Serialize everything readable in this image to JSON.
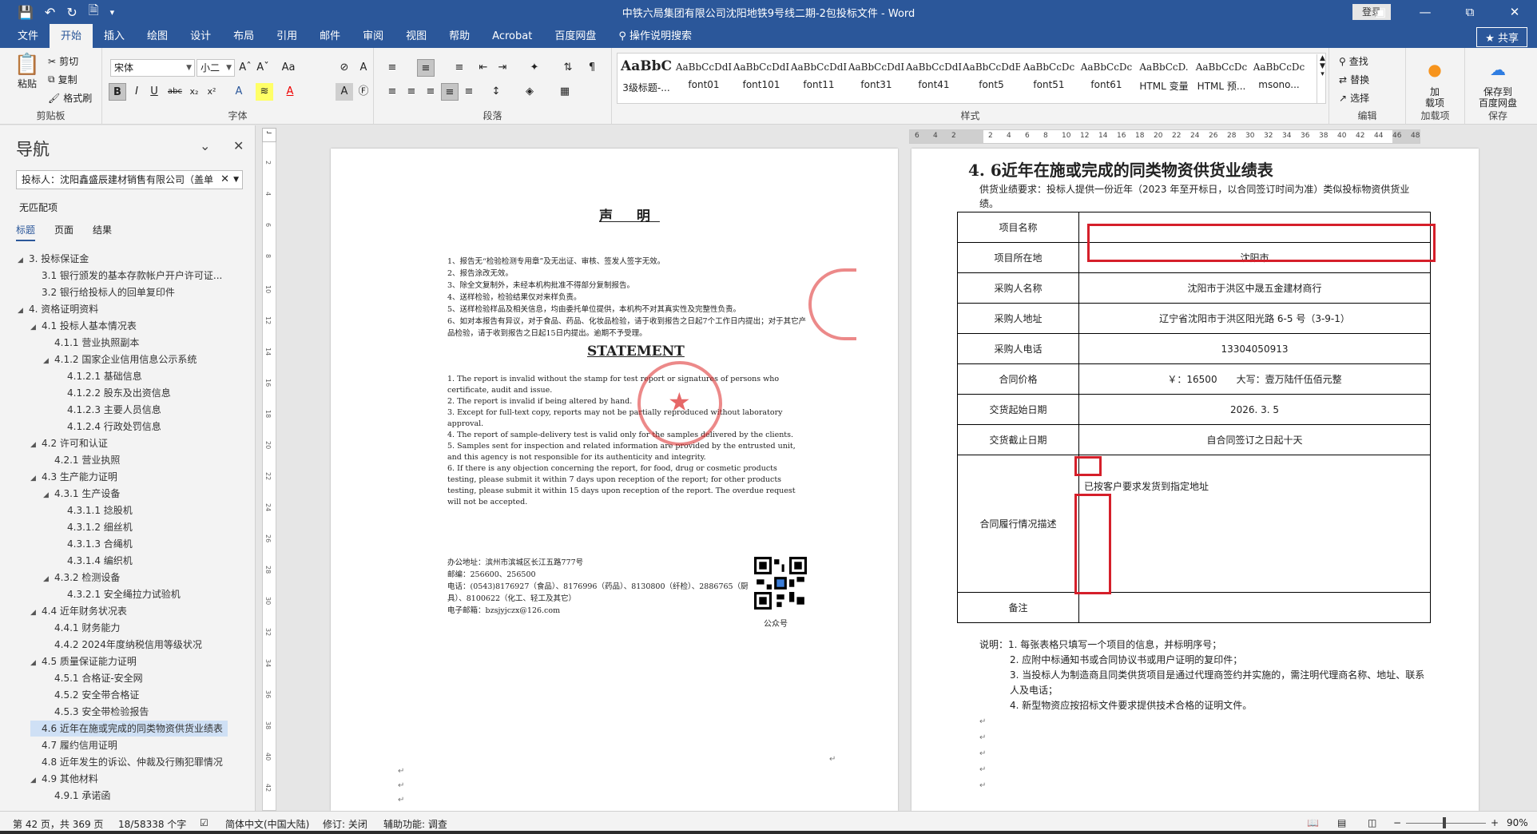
{
  "window": {
    "title": "中铁六局集团有限公司沈阳地铁9号线二期-2包投标文件 - Word",
    "login_label": "登录",
    "share_label": "共享",
    "qat_icons": [
      "save-icon",
      "undo-icon",
      "redo-icon",
      "new-doc-icon",
      "customize-icon"
    ]
  },
  "ribbon": {
    "tabs": [
      "文件",
      "开始",
      "插入",
      "绘图",
      "设计",
      "布局",
      "引用",
      "邮件",
      "审阅",
      "视图",
      "帮助",
      "Acrobat",
      "百度网盘"
    ],
    "active_tab": "开始",
    "tell_me": "操作说明搜索",
    "clipboard": {
      "paste": "粘贴",
      "cut": "剪切",
      "copy": "复制",
      "format_painter": "格式刷",
      "label": "剪贴板"
    },
    "font": {
      "name": "宋体",
      "size": "小二",
      "label": "字体"
    },
    "paragraph": {
      "label": "段落"
    },
    "styles": {
      "label": "样式",
      "items": [
        {
          "preview": "AaBbC",
          "name": "3级标题-..."
        },
        {
          "preview": "AaBbCcDdI",
          "name": "font01"
        },
        {
          "preview": "AaBbCcDdI",
          "name": "font101"
        },
        {
          "preview": "AaBbCcDdI",
          "name": "font11"
        },
        {
          "preview": "AaBbCcDdI",
          "name": "font31"
        },
        {
          "preview": "AaBbCcDdI",
          "name": "font41"
        },
        {
          "preview": "AaBbCcDdE",
          "name": "font5"
        },
        {
          "preview": "AaBbCcDc",
          "name": "font51"
        },
        {
          "preview": "AaBbCcDc",
          "name": "font61"
        },
        {
          "preview": "AaBbCcD.",
          "name": "HTML 变量"
        },
        {
          "preview": "AaBbCcDc",
          "name": "HTML 预..."
        },
        {
          "preview": "AaBbCcDc",
          "name": "msono..."
        }
      ]
    },
    "editing": {
      "find": "查找",
      "replace": "替换",
      "select": "选择",
      "label": "编辑"
    },
    "addins": {
      "button": "加\n载项",
      "label": "加载项"
    },
    "save_group": {
      "button": "保存到\n百度网盘",
      "label": "保存"
    }
  },
  "nav": {
    "title": "导航",
    "search_value": "投标人：沈阳鑫盛辰建材销售有限公司（盖单",
    "no_match": "无匹配项",
    "tabs": [
      "标题",
      "页面",
      "结果"
    ],
    "tree": [
      {
        "label": "3. 投标保证金",
        "level": 0,
        "expanded": true
      },
      {
        "label": "3.1 银行颁发的基本存款帐户开户许可证...",
        "level": 1
      },
      {
        "label": "3.2 银行给投标人的回单复印件",
        "level": 1
      },
      {
        "label": "4. 资格证明资料",
        "level": 0,
        "expanded": true
      },
      {
        "label": "4.1 投标人基本情况表",
        "level": 1,
        "expanded": true
      },
      {
        "label": "4.1.1 营业执照副本",
        "level": 2
      },
      {
        "label": "4.1.2 国家企业信用信息公示系统",
        "level": 2,
        "expanded": true
      },
      {
        "label": "4.1.2.1 基础信息",
        "level": 3
      },
      {
        "label": "4.1.2.2 股东及出资信息",
        "level": 3
      },
      {
        "label": "4.1.2.3 主要人员信息",
        "level": 3
      },
      {
        "label": "4.1.2.4 行政处罚信息",
        "level": 3
      },
      {
        "label": "4.2 许可和认证",
        "level": 1,
        "expanded": true
      },
      {
        "label": "4.2.1 营业执照",
        "level": 2
      },
      {
        "label": "4.3 生产能力证明",
        "level": 1,
        "expanded": true
      },
      {
        "label": "4.3.1 生产设备",
        "level": 2,
        "expanded": true
      },
      {
        "label": "4.3.1.1 捻股机",
        "level": 3
      },
      {
        "label": "4.3.1.2 细丝机",
        "level": 3
      },
      {
        "label": "4.3.1.3 合绳机",
        "level": 3
      },
      {
        "label": "4.3.1.4 编织机",
        "level": 3
      },
      {
        "label": "4.3.2 检测设备",
        "level": 2,
        "expanded": true
      },
      {
        "label": "4.3.2.1 安全绳拉力试验机",
        "level": 3
      },
      {
        "label": "4.4 近年财务状况表",
        "level": 1,
        "expanded": true
      },
      {
        "label": "4.4.1 财务能力",
        "level": 2
      },
      {
        "label": "4.4.2 2024年度纳税信用等级状况",
        "level": 2
      },
      {
        "label": "4.5 质量保证能力证明",
        "level": 1,
        "expanded": true
      },
      {
        "label": "4.5.1 合格证-安全网",
        "level": 2
      },
      {
        "label": "4.5.2 安全带合格证",
        "level": 2
      },
      {
        "label": "4.5.3 安全带检验报告",
        "level": 2
      },
      {
        "label": "4.6 近年在施或完成的同类物资供货业绩表",
        "level": 1,
        "selected": true
      },
      {
        "label": "4.7 履约信用证明",
        "level": 1
      },
      {
        "label": "4.8 近年发生的诉讼、仲裁及行贿犯罪情况",
        "level": 1
      },
      {
        "label": "4.9 其他材料",
        "level": 1,
        "expanded": true
      },
      {
        "label": "4.9.1 承诺函",
        "level": 2
      }
    ]
  },
  "ruler": {
    "ticks": [
      "6",
      "4",
      "2",
      "",
      "2",
      "4",
      "6",
      "8",
      "10",
      "12",
      "14",
      "16",
      "18",
      "20",
      "22",
      "24",
      "26",
      "28",
      "30",
      "32",
      "34",
      "36",
      "38",
      "40",
      "42",
      "44",
      "46",
      "48"
    ],
    "vticks": [
      "2",
      "4",
      "6",
      "8",
      "10",
      "12",
      "14",
      "16",
      "18",
      "20",
      "22",
      "24",
      "26",
      "28",
      "30",
      "32",
      "34",
      "36",
      "38",
      "40",
      "42"
    ]
  },
  "page1": {
    "decl_title": "声 明",
    "cn_items": [
      "1、报告无“检验检测专用章”及无出证、审核、签发人签字无效。",
      "2、报告涂改无效。",
      "3、除全文复制外，未经本机构批准不得部分复制报告。",
      "4、送样检验，检验结果仅对来样负责。",
      "5、送样检验样品及相关信息，均由委托单位提供，本机构不对其真实性及完整性负责。",
      "6、如对本报告有异议，对于食品、药品、化妆品检验，请于收到报告之日起7个工作日内提出；对于其它产品检验，请于收到报告之日起15日内提出。逾期不予受理。"
    ],
    "stmt_title": "STATEMENT",
    "en_items": [
      "1. The report is invalid without the stamp for test report or signatures of persons who certificate, audit and issue.",
      "2. The report is invalid if being altered by hand.",
      "3. Except for full-text copy, reports may not be partially reproduced without laboratory approval.",
      "4. The report of sample-delivery test is valid only for the samples delivered by the clients.",
      "5. Samples sent for inspection and related information are provided by the entrusted unit, and this agency is not responsible for its authenticity and integrity.",
      "6. If there is any objection concerning the report, for food, drug or cosmetic products testing, please submit it within 7 days upon reception of the report; for other products testing, please submit it within 15 days upon reception of the report. The overdue request will not be accepted."
    ],
    "contact": [
      "办公地址：滨州市滨城区长江五路777号",
      "邮编：256600、256500",
      "电话：(0543)8176927（食品）、8176996（药品）、8130800（纤检）、2886765（厨具）、8100622（化工、轻工及其它）",
      "电子邮箱：bzsjyjczx@126.com"
    ],
    "qr_label": "公众号"
  },
  "page2": {
    "section_title": "4. 6近年在施或完成的同类物资供货业绩表",
    "requirement": "供货业绩要求：投标人提供一份近年（2023 年至开标日，以合同签订时间为准）类似投标物资供货业绩。",
    "table": [
      {
        "label": "项目名称",
        "value": ""
      },
      {
        "label": "项目所在地",
        "value": "沈阳市"
      },
      {
        "label": "采购人名称",
        "value": "沈阳市于洪区中晟五金建材商行"
      },
      {
        "label": "采购人地址",
        "value": "辽宁省沈阳市于洪区阳光路 6-5 号（3-9-1）"
      },
      {
        "label": "采购人电话",
        "value": "13304050913"
      },
      {
        "label": "合同价格",
        "value": "￥：16500　　大写：壹万陆仟伍佰元整"
      },
      {
        "label": "交货起始日期",
        "value": "2026. 3. 5"
      },
      {
        "label": "交货截止日期",
        "value": "自合同签订之日起十天"
      },
      {
        "label": "合同履行情况描述",
        "value": "已按客户要求发货到指定地址"
      },
      {
        "label": "备注",
        "value": ""
      }
    ],
    "notes": [
      "说明：1. 每张表格只填写一个项目的信息，并标明序号；",
      "2. 应附中标通知书或合同协议书或用户证明的复印件；",
      "3. 当投标人为制造商且同类供货项目是通过代理商签约并实施的，需注明代理商名称、地址、联系人及电话；",
      "4. 新型物资应按招标文件要求提供技术合格的证明文件。"
    ]
  },
  "status": {
    "page": "第 42 页，共 369 页",
    "words": "18/58338 个字",
    "language": "简体中文(中国大陆)",
    "track": "修订: 关闭",
    "accessibility": "辅助功能: 调查",
    "zoom": "90%"
  }
}
